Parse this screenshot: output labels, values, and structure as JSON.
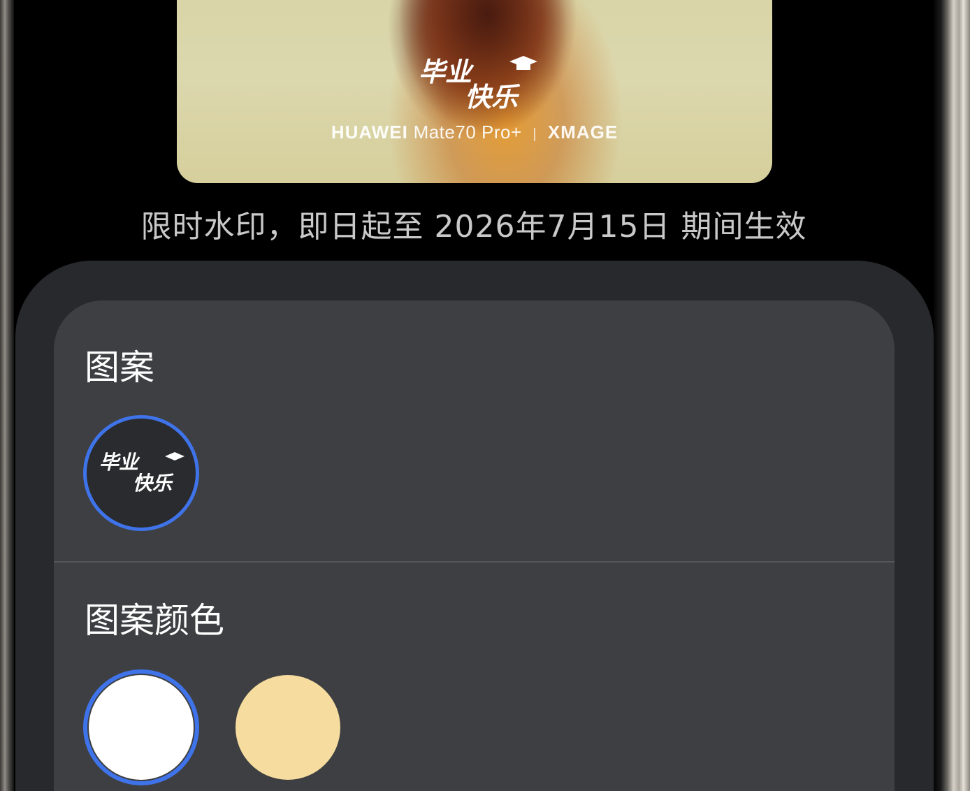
{
  "preview": {
    "logo_text": "毕业快乐",
    "brand_bold": "HUAWEI",
    "brand_model": "Mate70 Pro+",
    "brand_separator": "|",
    "brand_sub": "XMAGE"
  },
  "notice": "限时水印，即日起至 2026年7月15日 期间生效",
  "sections": {
    "pattern": {
      "title": "图案",
      "options": [
        {
          "label": "毕业快乐",
          "selected": true
        }
      ]
    },
    "pattern_color": {
      "title": "图案颜色",
      "options": [
        {
          "color": "#ffffff",
          "selected": true
        },
        {
          "color": "#f6dd9f",
          "selected": false
        }
      ]
    }
  },
  "colors": {
    "accent": "#3f73ea",
    "sheet_background": "#28292c",
    "card_background": "#3e3f42"
  }
}
